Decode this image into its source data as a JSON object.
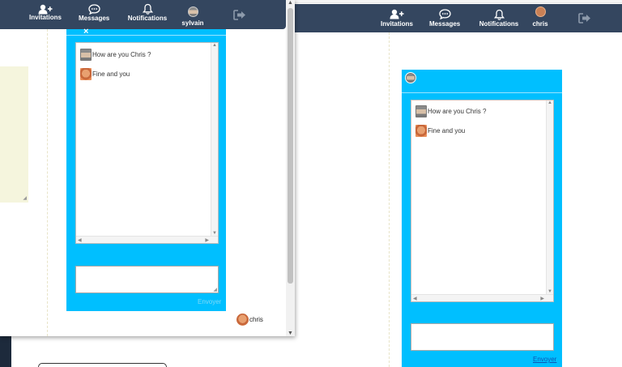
{
  "left_window": {
    "navbar": {
      "invitations_label": "Invitations",
      "messages_label": "Messages",
      "notifications_label": "Notifications",
      "user_label": "sylvain"
    },
    "chat": {
      "close_label": "×",
      "messages": [
        {
          "author": "sylvain",
          "text": "How are you Chris ?"
        },
        {
          "author": "chris",
          "text": "Fine and you"
        }
      ],
      "input_value": "",
      "send_label": "Envoyer"
    },
    "footer_user": "chris"
  },
  "right_window": {
    "navbar": {
      "invitations_label": "Invitations",
      "messages_label": "Messages",
      "notifications_label": "Notifications",
      "user_label": "chris"
    },
    "chat": {
      "messages": [
        {
          "author": "sylvain",
          "text": "How are you Chris ?"
        },
        {
          "author": "chris",
          "text": "Fine and you"
        }
      ],
      "input_value": "",
      "send_label": "Envoyer"
    }
  },
  "colors": {
    "navbar": "#34465f",
    "chat_accent": "#00bfff",
    "side_panel": "#f5f5dd"
  },
  "icons": {
    "invitations": "add-user-icon",
    "messages": "speech-bubble-icon",
    "notifications": "bell-icon",
    "logout": "sign-out-icon"
  }
}
